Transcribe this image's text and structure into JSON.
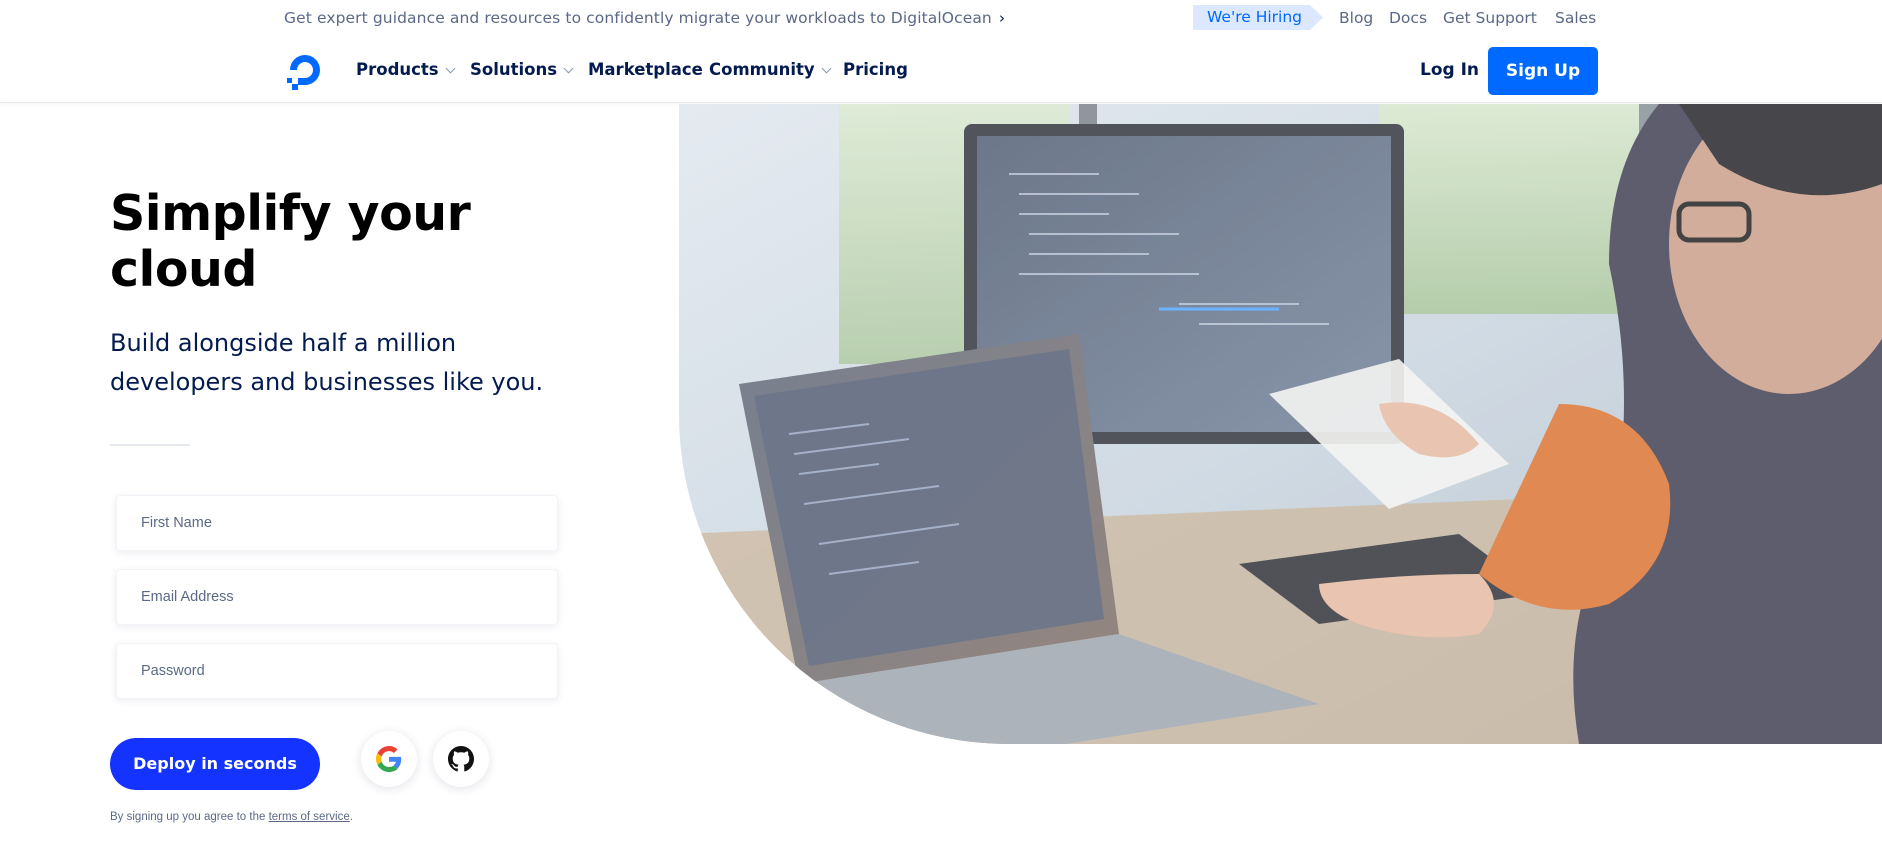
{
  "banner": {
    "message": "Get expert guidance and resources to confidently migrate your workloads to DigitalOcean",
    "message_chevron": "›",
    "hiring_label": "We're Hiring",
    "links": [
      "Blog",
      "Docs",
      "Get Support",
      "Sales"
    ]
  },
  "nav": {
    "logo_icon": "digitalocean-logo-icon",
    "items": [
      {
        "label": "Products",
        "dropdown": true
      },
      {
        "label": "Solutions",
        "dropdown": true
      },
      {
        "label": "Marketplace",
        "dropdown": false
      },
      {
        "label": "Community",
        "dropdown": true
      },
      {
        "label": "Pricing",
        "dropdown": false
      }
    ],
    "login_label": "Log In",
    "signup_label": "Sign Up"
  },
  "hero": {
    "headline": "Simplify your cloud",
    "subhead": "Build alongside half a million developers and businesses like you.",
    "form": {
      "first_name_placeholder": "First Name",
      "email_placeholder": "Email Address",
      "password_placeholder": "Password"
    },
    "deploy_label": "Deploy in seconds",
    "social_icons": [
      "google-icon",
      "github-icon"
    ],
    "legal_prefix": "By signing up you agree to the ",
    "legal_link": "terms of service",
    "legal_suffix": "."
  },
  "colors": {
    "brand_blue": "#0069ff",
    "deploy_blue": "#1433ff",
    "navy_text": "#031b4e",
    "muted_text": "#5b6987",
    "hiring_bg": "#dbe8ff"
  }
}
